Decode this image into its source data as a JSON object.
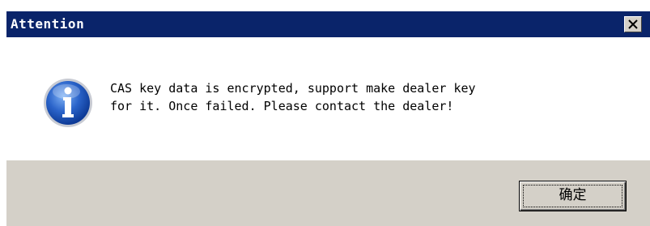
{
  "window": {
    "title": "Attention",
    "close_icon": "close-icon"
  },
  "message": {
    "icon": "info-icon",
    "line1": "CAS key data is encrypted, support make dealer key",
    "line2": "for it. Once failed. Please contact the dealer!"
  },
  "buttons": {
    "ok_label": "确定"
  },
  "colors": {
    "titlebar": "#0a246a",
    "title_text": "#ffffff",
    "dialog_face": "#d4d0c8",
    "content_bg": "#ffffff",
    "info_blue": "#2a63c9"
  }
}
